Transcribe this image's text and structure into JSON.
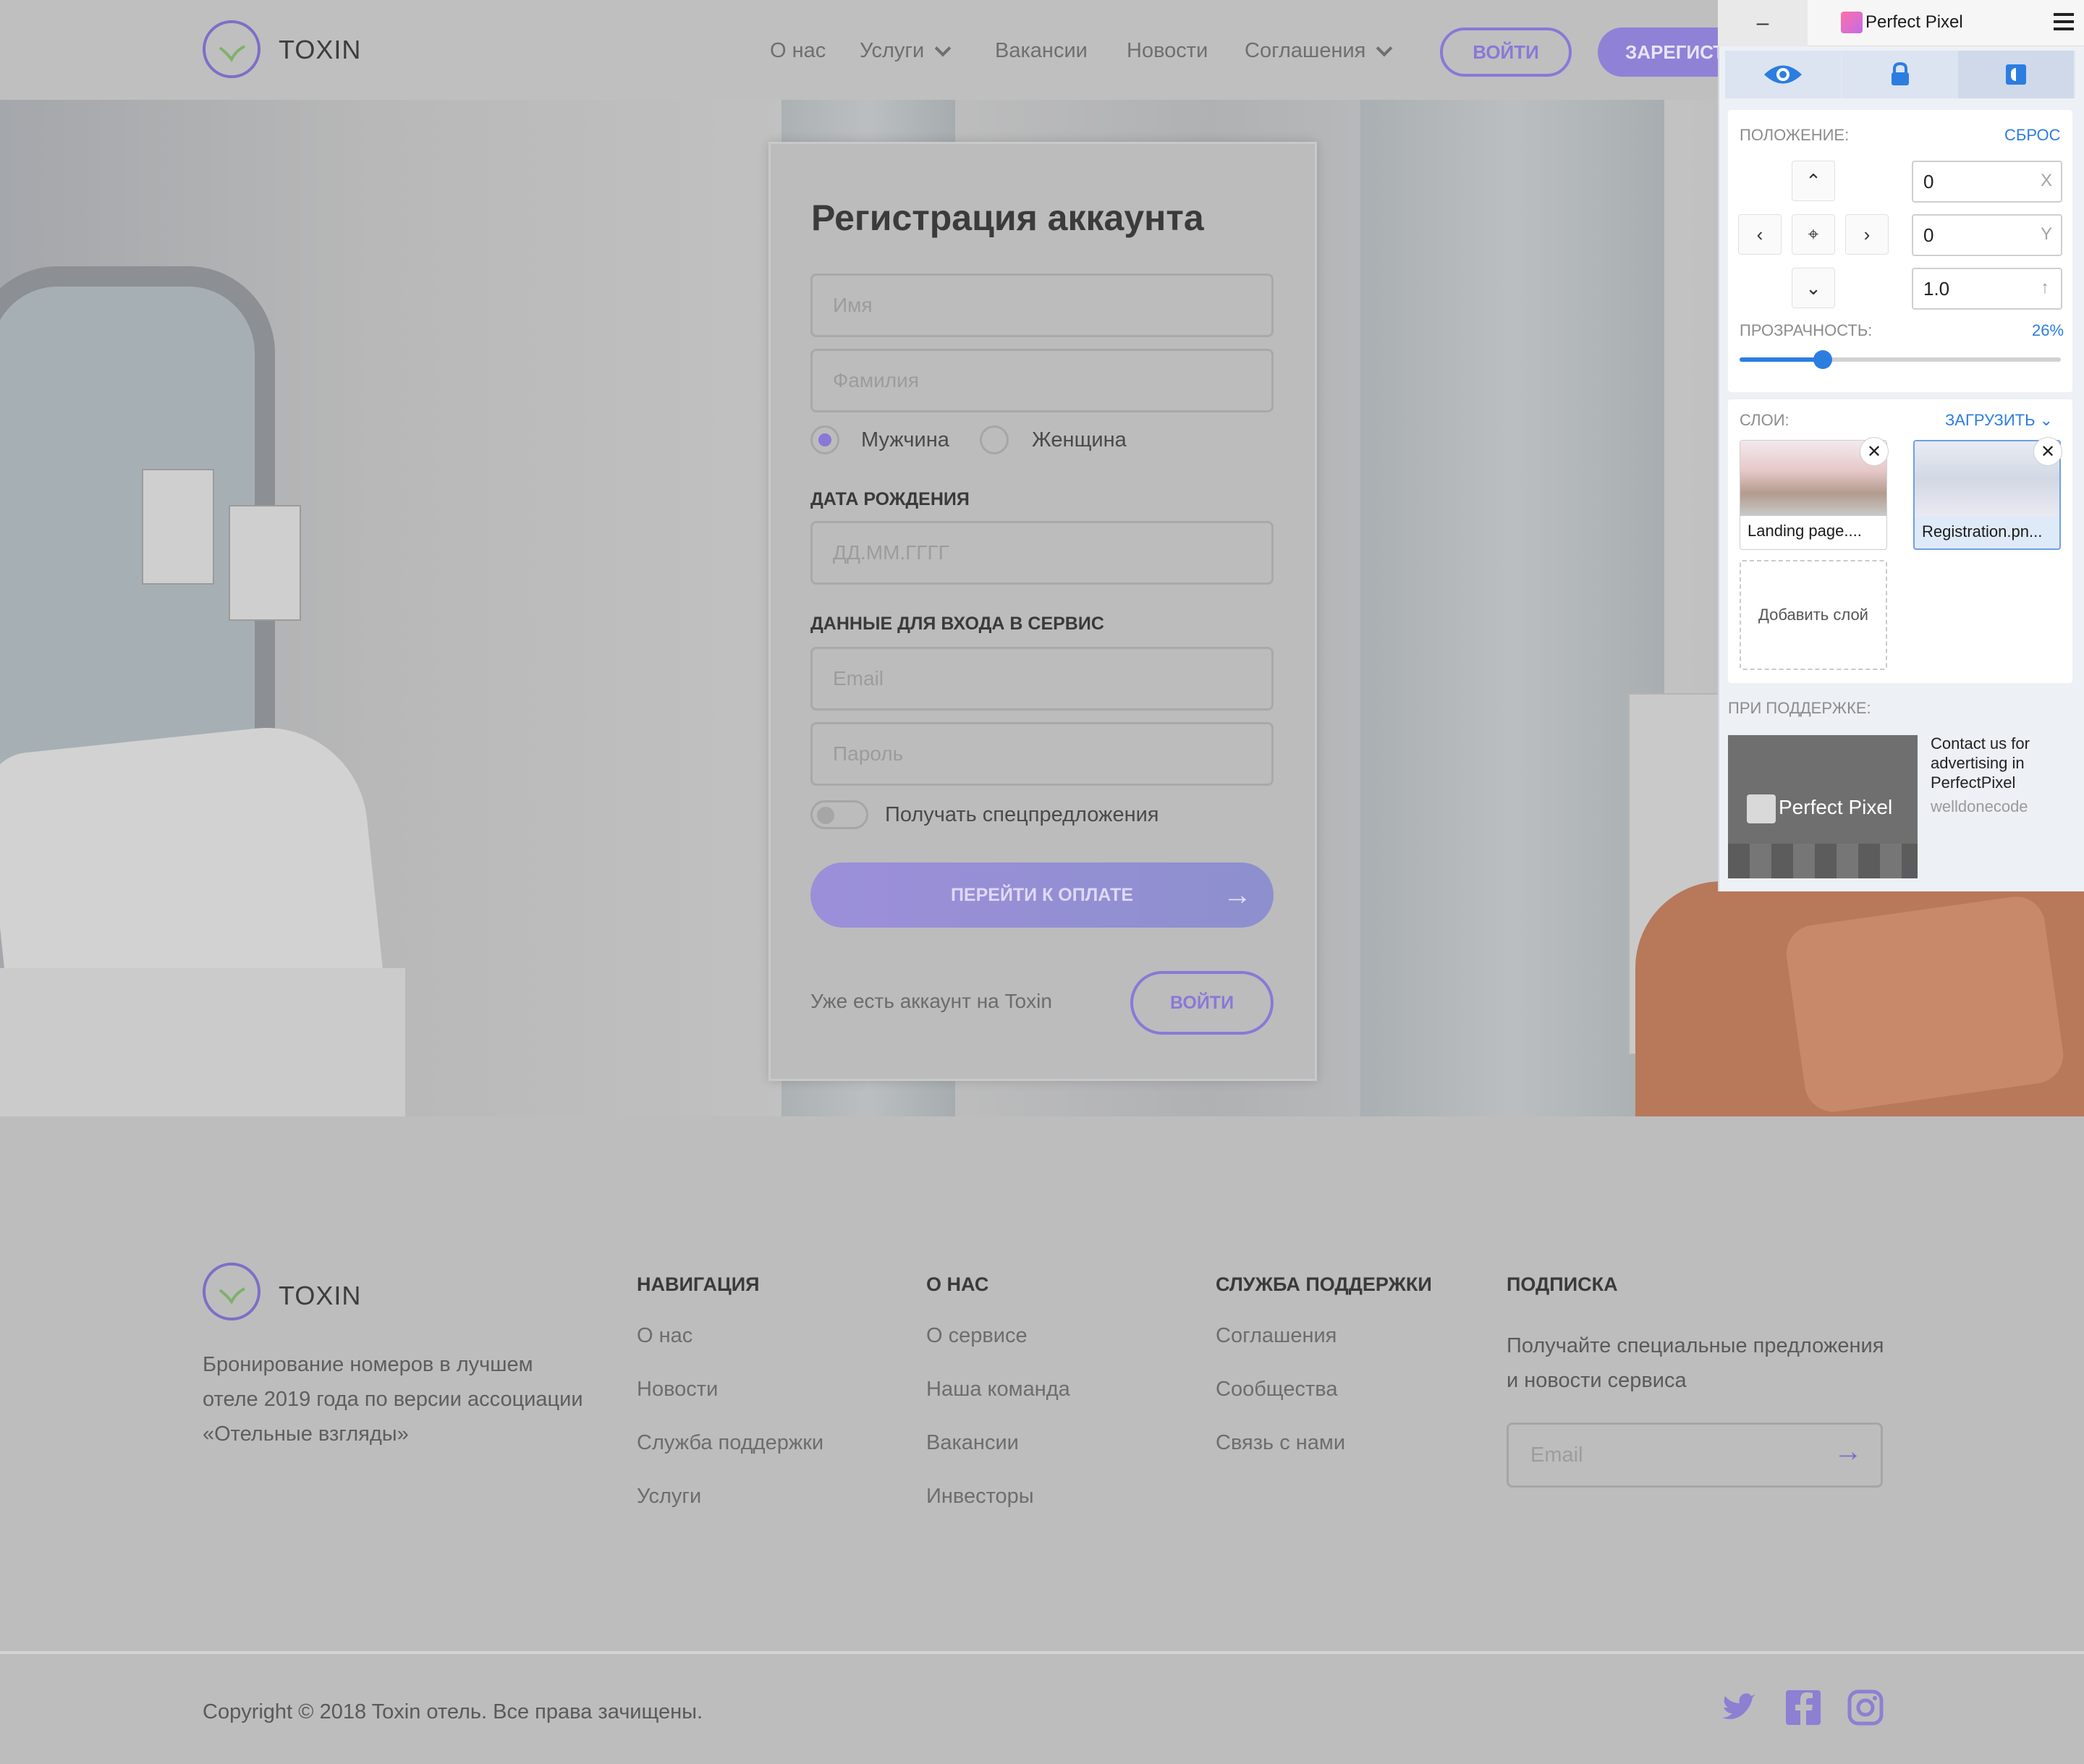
{
  "header": {
    "brand": "TOXIN",
    "nav": [
      "О нас",
      "Услуги",
      "Вакансии",
      "Новости",
      "Соглашения"
    ],
    "login": "ВОЙТИ",
    "register": "ЗАРЕГИСТ"
  },
  "form": {
    "title": "Регистрация аккаунта",
    "first_name_placeholder": "Имя",
    "last_name_placeholder": "Фамилия",
    "gender_male": "Мужчина",
    "gender_female": "Женщина",
    "birth_label": "ДАТА РОЖДЕНИЯ",
    "birth_placeholder": "ДД.ММ.ГГГГ",
    "login_section": "ДАННЫЕ ДЛЯ ВХОДА В СЕРВИС",
    "email_placeholder": "Email",
    "password_placeholder": "Пароль",
    "offers_toggle": "Получать спецпредложения",
    "submit": "ПЕРЕЙТИ К ОПЛАТЕ",
    "have_account": "Уже есть аккаунт на Toxin",
    "login": "ВОЙТИ"
  },
  "footer": {
    "brand": "TOXIN",
    "description": "Бронирование номеров в лучшем отеле 2019 года по версии ассоциации «Отельные взгляды»",
    "columns": [
      {
        "title": "НАВИГАЦИЯ",
        "links": [
          "О нас",
          "Новости",
          "Служба поддержки",
          "Услуги"
        ]
      },
      {
        "title": "О НАС",
        "links": [
          "О сервисе",
          "Наша команда",
          "Вакансии",
          "Инвесторы"
        ]
      },
      {
        "title": "СЛУЖБА ПОДДЕРЖКИ",
        "links": [
          "Соглашения",
          "Сообщества",
          "Связь с нами"
        ]
      }
    ],
    "subscribe": {
      "title": "ПОДПИСКА",
      "description": "Получайте специальные предложения и новости сервиса",
      "placeholder": "Email"
    },
    "copyright": "Copyright © 2018 Toxin отель. Все права зачищены."
  },
  "perfect_pixel": {
    "title": "Perfect Pixel",
    "minimize": "–",
    "position_label": "ПОЛОЖЕНИЕ:",
    "reset": "СБРОС",
    "x_value": "0",
    "y_value": "0",
    "scale_value": "1.0",
    "x_axis": "X",
    "y_axis": "Y",
    "opacity_label": "ПРОЗРАЧНОСТЬ:",
    "opacity_value": "26%",
    "opacity_fraction": 0.26,
    "layers_label": "СЛОИ:",
    "upload": "ЗАГРУЗИТЬ",
    "layers": [
      "Landing page....",
      "Registration.pn..."
    ],
    "add_layer": "Добавить слой",
    "sponsor_label": "ПРИ ПОДДЕРЖКЕ:",
    "ad_brand": "Perfect Pixel",
    "ad_text": "Contact us for advertising in PerfectPixel",
    "ad_link": "welldonecode"
  },
  "colors": {
    "accent": "#8a78d8",
    "pp_blue": "#2c7de0"
  }
}
